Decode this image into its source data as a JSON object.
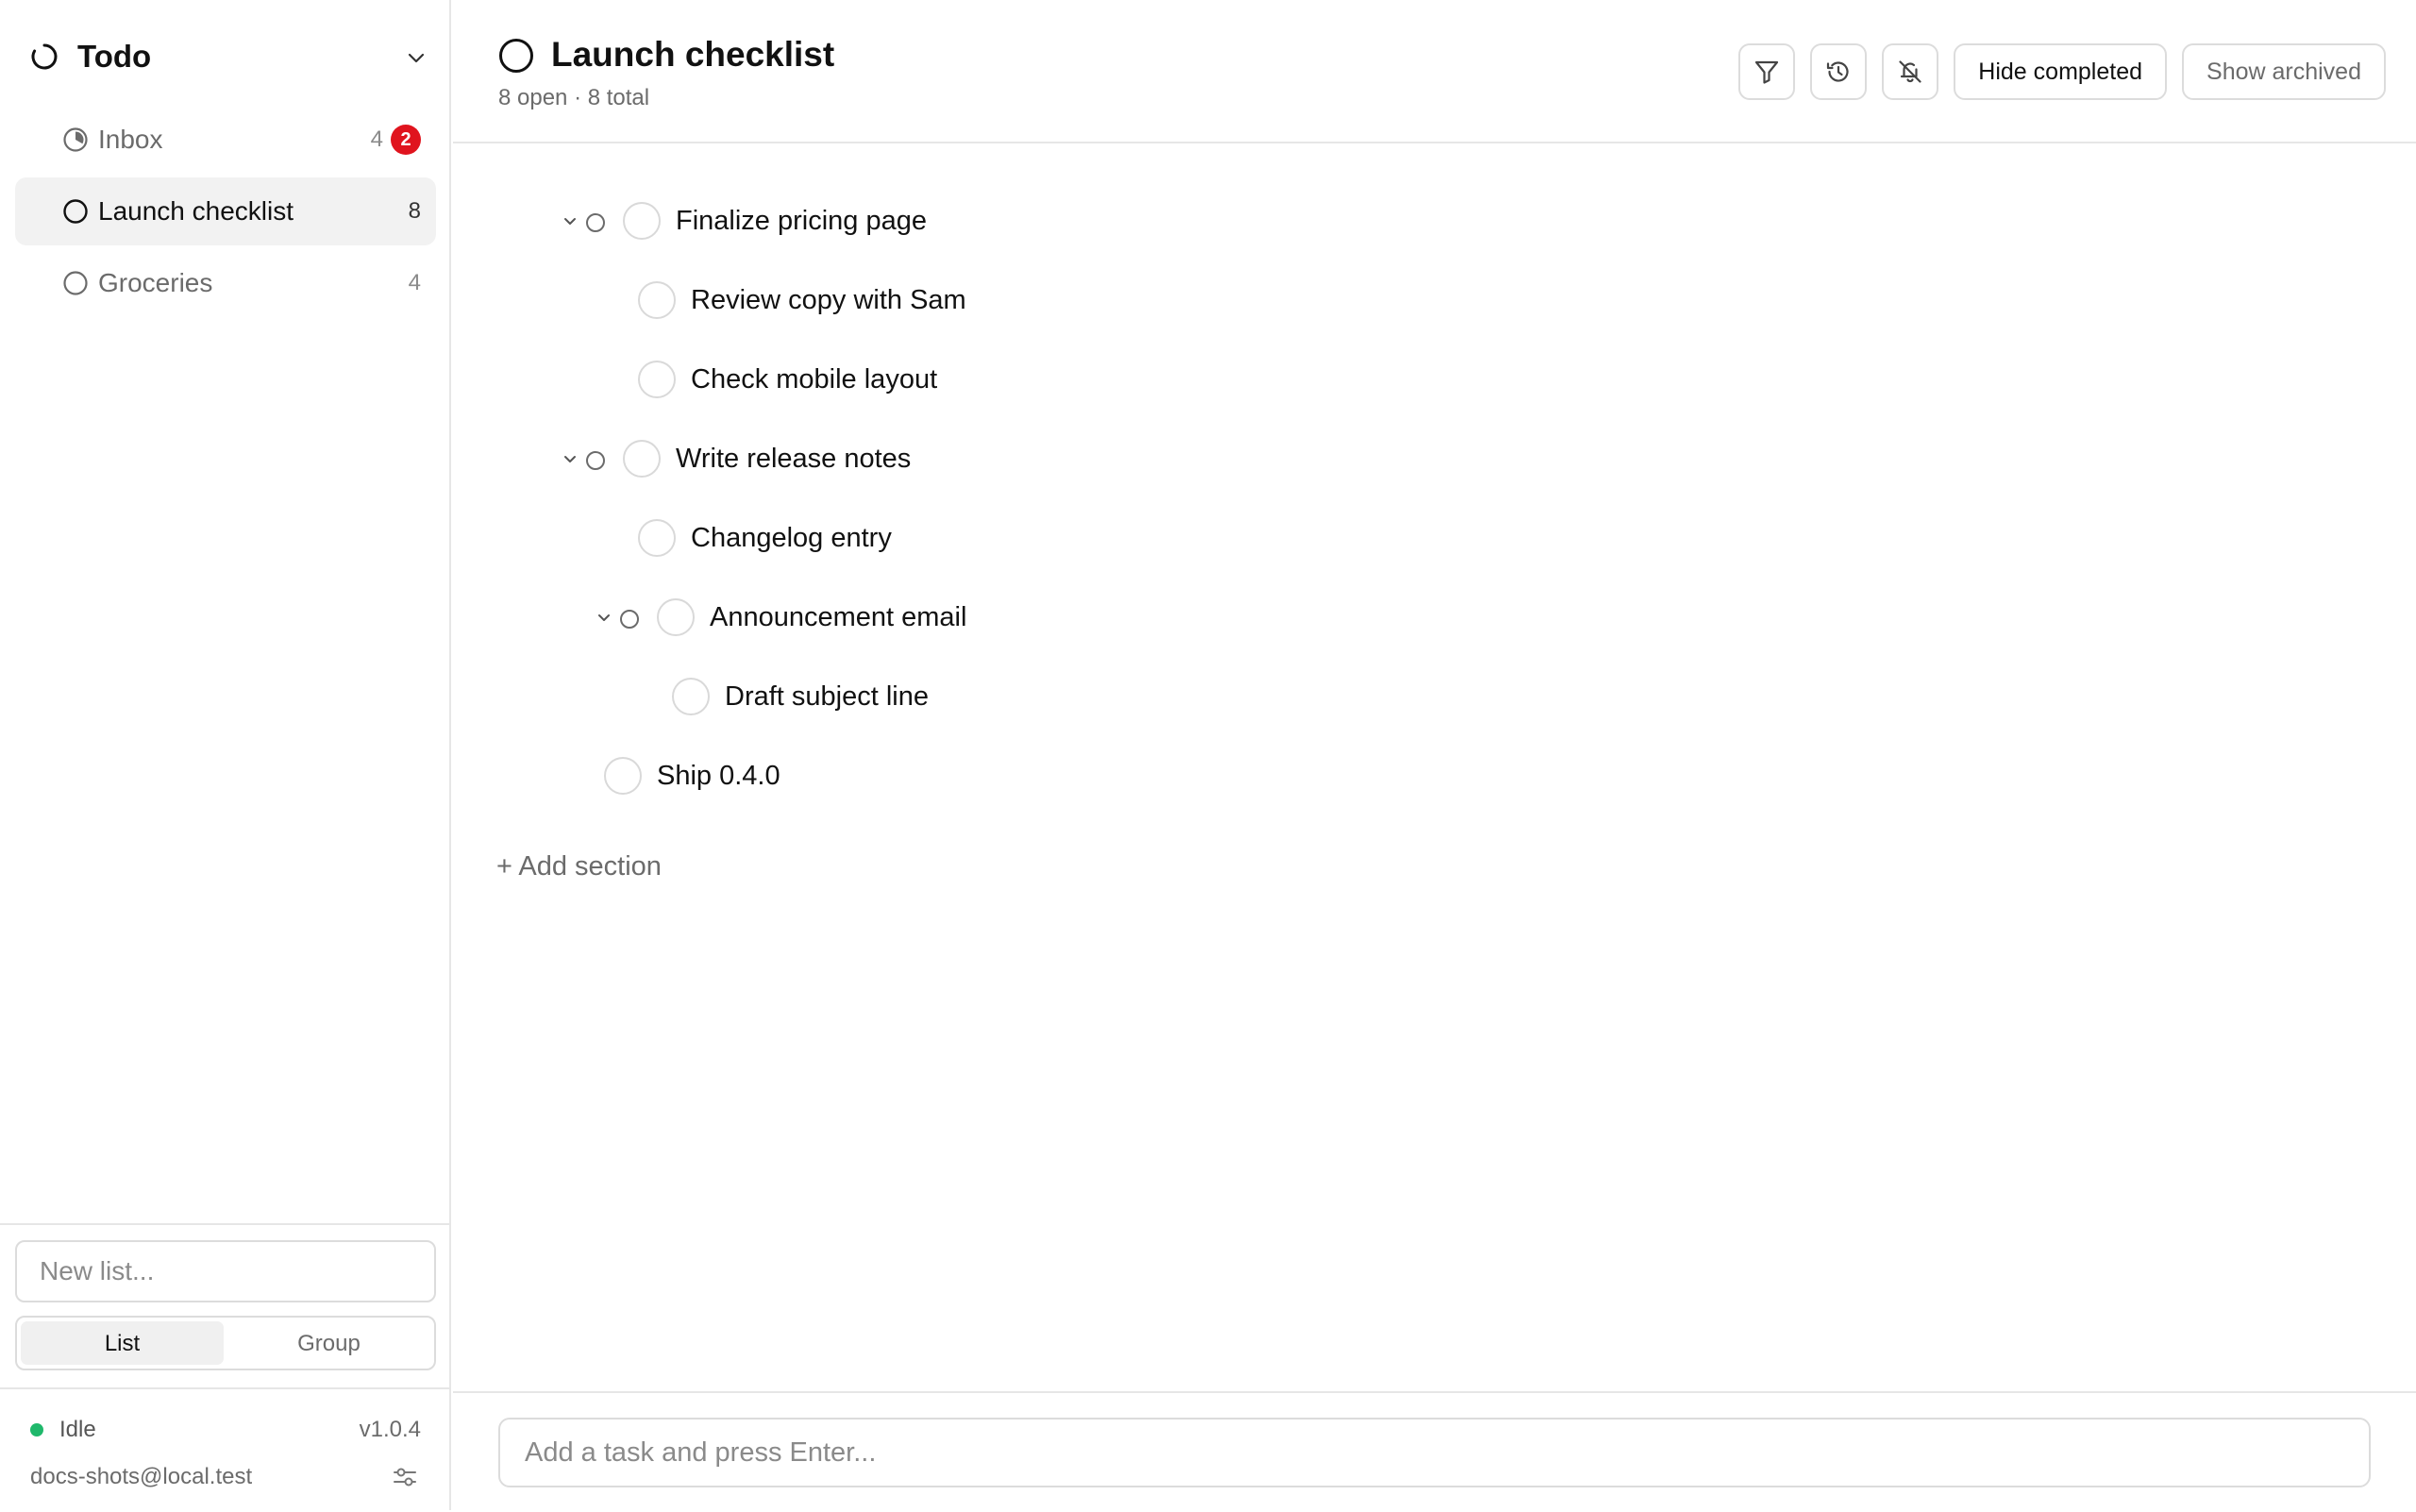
{
  "app": {
    "title": "Todo",
    "accent_color": "#111111"
  },
  "sidebar": {
    "lists": [
      {
        "label": "Inbox",
        "count": "4",
        "badge": "2",
        "icon": "progress-circle-icon"
      },
      {
        "label": "Launch checklist",
        "count": "8",
        "icon": "circle-icon",
        "active": true
      },
      {
        "label": "Groceries",
        "count": "4",
        "icon": "circle-icon"
      }
    ],
    "new_list_placeholder": "New list...",
    "view_toggle": {
      "list": "List",
      "group": "Group",
      "selected": "List"
    },
    "status": {
      "state": "Idle",
      "color": "#1fb86b"
    },
    "version": "v1.0.4",
    "account": "docs-shots@local.test"
  },
  "header": {
    "title": "Launch checklist",
    "subtitle": "8 open · 8 total",
    "buttons": {
      "filter_icon": "filter-icon",
      "history_icon": "history-icon",
      "notifications_icon": "bell-off-icon",
      "hide_completed": "Hide completed",
      "show_archived": "Show archived"
    }
  },
  "tasks": [
    {
      "label": "Finalize pricing page",
      "expanded": true
    },
    {
      "label": "Review copy with Sam"
    },
    {
      "label": "Check mobile layout"
    },
    {
      "label": "Write release notes",
      "expanded": true
    },
    {
      "label": "Changelog entry"
    },
    {
      "label": "Announcement email",
      "expanded": true
    },
    {
      "label": "Draft subject line"
    },
    {
      "label": "Ship 0.4.0"
    }
  ],
  "add_section_label": "+ Add section",
  "composer_placeholder": "Add a task and press Enter...",
  "colors": {
    "badge": "#e0141e",
    "status_idle": "#1fb86b",
    "active_bg": "#f2f2f2",
    "muted_text": "#6b6b6b"
  }
}
